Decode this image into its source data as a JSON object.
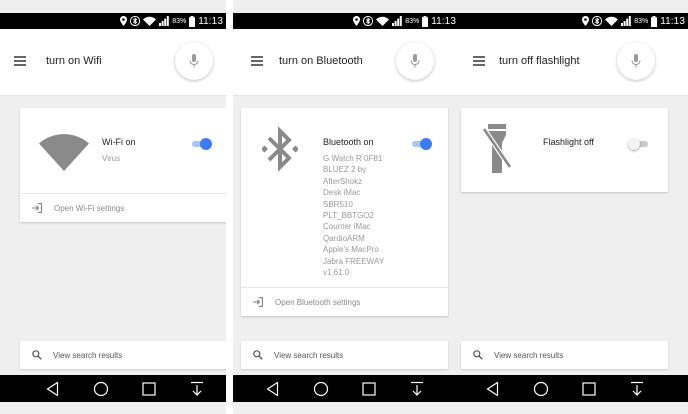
{
  "status_bar": {
    "time": "11:13",
    "battery": "83%"
  },
  "panels": [
    {
      "query": "turn on Wifi",
      "card": {
        "title": "Wi-Fi on",
        "subtitle_lines": [
          "Virus"
        ],
        "toggle_state": "on",
        "link_label": "Open Wi-Fi settings"
      },
      "results_label": "View search results"
    },
    {
      "query": "turn on Bluetooth",
      "card": {
        "title": "Bluetooth on",
        "subtitle_lines": [
          "G Watch R 0F81",
          "BLUEZ 2 by",
          "AfterShokz",
          "Desk iMac",
          "SBR510",
          "PLT_BBTGO2",
          "Counter iMac",
          "QardioARM",
          "Apple's MacPro",
          "Jabra FREEWAY",
          "v1.61.0"
        ],
        "toggle_state": "on",
        "link_label": "Open Bluetooth settings"
      },
      "results_label": "View search results"
    },
    {
      "query": "turn off flashlight",
      "card": {
        "title": "Flashlight off",
        "subtitle_lines": [],
        "toggle_state": "off"
      },
      "results_label": "View search results"
    }
  ],
  "icons": {
    "status": [
      "location-pin-icon",
      "bluetooth-icon",
      "wifi-icon",
      "cell-signal-icon",
      "battery-icon"
    ],
    "search_bar": [
      "menu-icon",
      "mic-icon"
    ],
    "cards": [
      "wifi-icon",
      "bluetooth-icon",
      "flashlight-off-icon",
      "open-settings-icon"
    ],
    "results": "search-icon",
    "navigation": [
      "back-icon",
      "home-icon",
      "recents-icon",
      "download-icon"
    ]
  },
  "colors": {
    "toggle_on": "#3d7bf0",
    "card_icon": "#8a8a8a",
    "status_bar": "#000000",
    "nav_bar": "#000000",
    "background": "#efefef"
  }
}
